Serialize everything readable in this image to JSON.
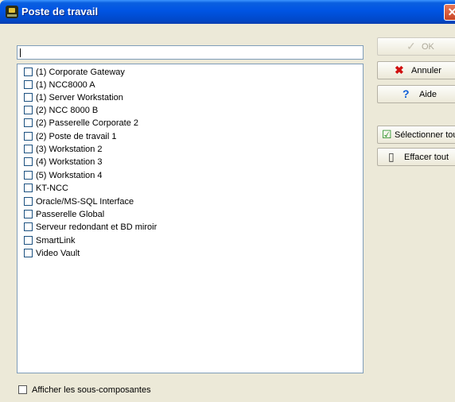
{
  "window": {
    "title": "Poste de travail"
  },
  "search": {
    "value": ""
  },
  "list": {
    "items": [
      {
        "label": "(1) Corporate Gateway",
        "checked": false
      },
      {
        "label": "(1) NCC8000 A",
        "checked": false
      },
      {
        "label": "(1) Server Workstation",
        "checked": false
      },
      {
        "label": "(2) NCC 8000 B",
        "checked": false
      },
      {
        "label": "(2) Passerelle Corporate 2",
        "checked": false
      },
      {
        "label": "(2) Poste de travail 1",
        "checked": false
      },
      {
        "label": "(3) Workstation 2",
        "checked": false
      },
      {
        "label": "(4) Workstation 3",
        "checked": false
      },
      {
        "label": "(5) Workstation 4",
        "checked": false
      },
      {
        "label": "KT-NCC",
        "checked": false
      },
      {
        "label": "Oracle/MS-SQL Interface",
        "checked": false
      },
      {
        "label": "Passerelle Global",
        "checked": false
      },
      {
        "label": "Serveur redondant et BD miroir",
        "checked": false
      },
      {
        "label": "SmartLink",
        "checked": false
      },
      {
        "label": "Video Vault",
        "checked": false
      }
    ]
  },
  "footer": {
    "show_subcomponents_label": "Afficher les sous-composantes",
    "checked": false
  },
  "buttons": {
    "ok": "OK",
    "cancel": "Annuler",
    "help": "Aide",
    "select_all": "Sélectionner tout",
    "clear_all": "Effacer tout"
  },
  "colors": {
    "titlebar": "#0054e3",
    "window_bg": "#ece9d8",
    "border": "#7f9db9",
    "close": "#c84524"
  },
  "icons": {
    "title": "workstation-app-icon",
    "close": "close-icon",
    "ok": "checkmark-icon",
    "cancel": "red-x-icon",
    "help": "question-mark-icon",
    "select_all": "green-checkbox-icon",
    "clear_all": "empty-list-icon"
  }
}
